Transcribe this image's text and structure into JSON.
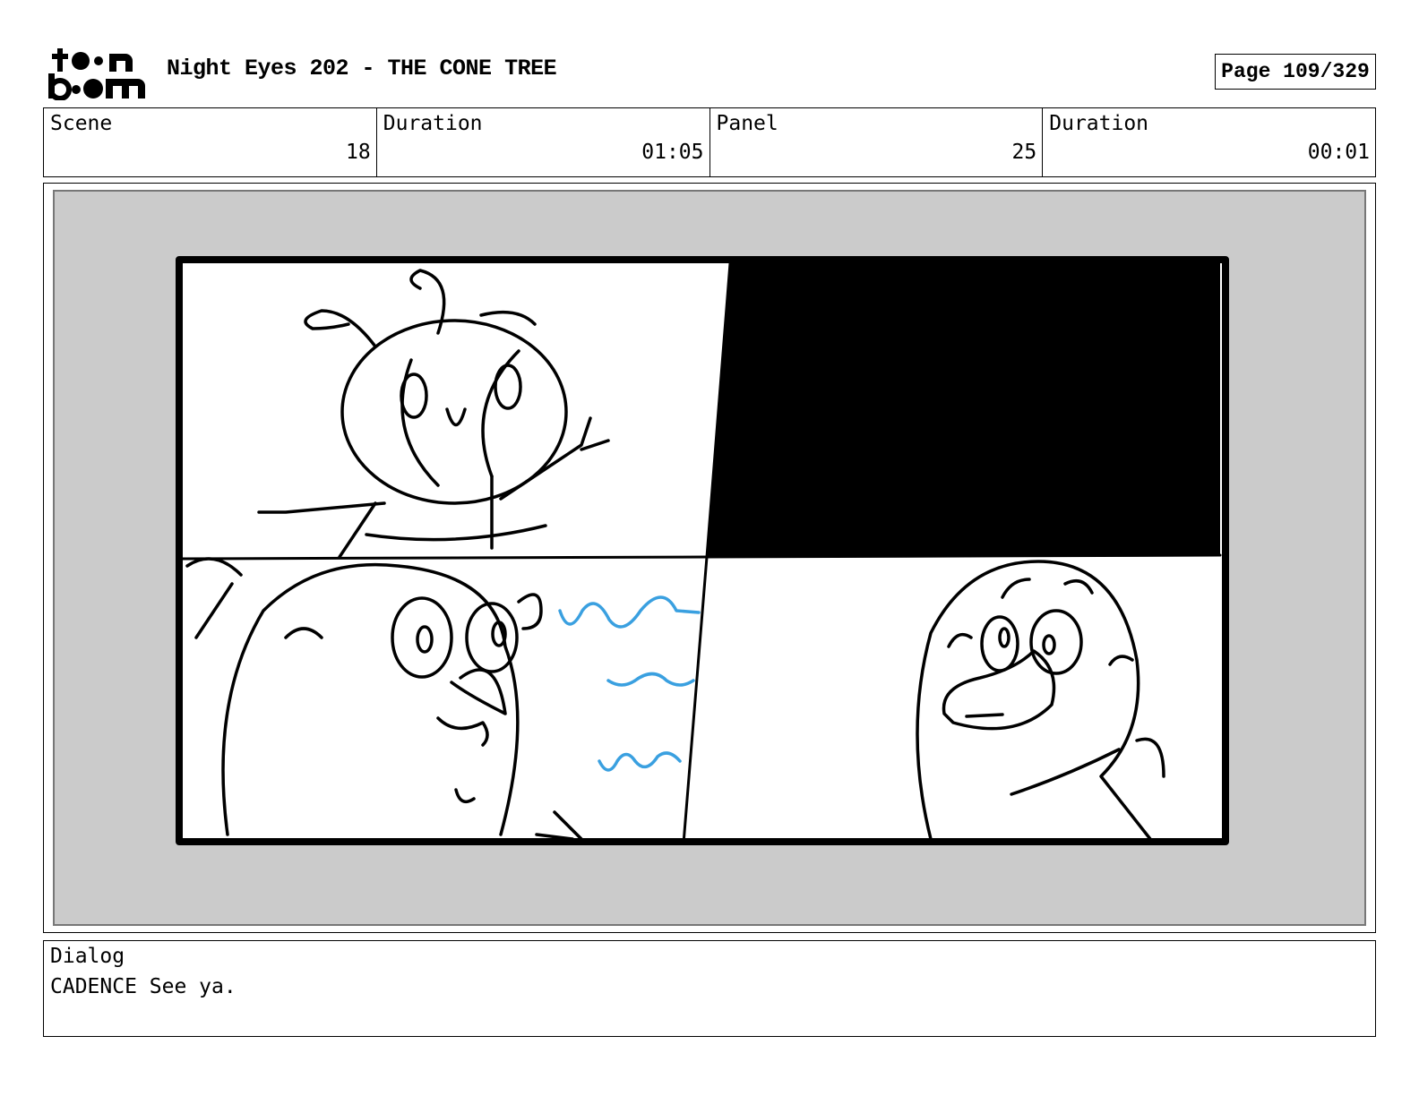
{
  "header": {
    "title": "Night Eyes 202 - THE CONE TREE",
    "page": "Page 109/329",
    "logo_text_top": "toon",
    "logo_text_bottom": "boom"
  },
  "info": {
    "scene_label": "Scene",
    "scene_value": "18",
    "scene_duration_label": "Duration",
    "scene_duration_value": "01:05",
    "panel_label": "Panel",
    "panel_value": "25",
    "panel_duration_label": "Duration",
    "panel_duration_value": "00:01"
  },
  "dialog": {
    "label": "Dialog",
    "text": "CADENCE See ya."
  },
  "colors": {
    "frame_bg": "#cbcbcb",
    "sketch_line": "#000000",
    "accent_blue": "#3aa0e0"
  }
}
